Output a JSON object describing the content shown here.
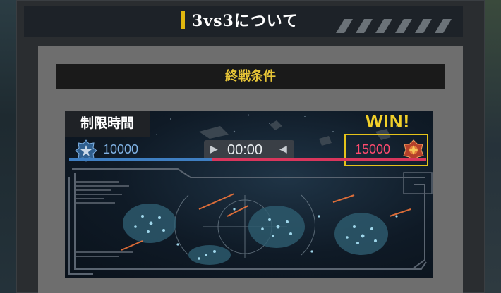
{
  "header": {
    "title": "3vs3について"
  },
  "section": {
    "title": "終戦条件"
  },
  "screen": {
    "tag": "制限時間",
    "win_label": "WIN!",
    "timer": "00:00",
    "blue_score": "10000",
    "red_score": "15000",
    "score_bar": {
      "blue": 10000,
      "red": 15000
    },
    "colors": {
      "blue": "#3f7fc2",
      "red": "#d9365c",
      "accent": "#e5c31a"
    }
  },
  "icons": {
    "blue_emblem": "blue-team-emblem-icon",
    "red_emblem": "red-team-emblem-icon",
    "play": "play-icon",
    "rewind": "rewind-icon"
  }
}
